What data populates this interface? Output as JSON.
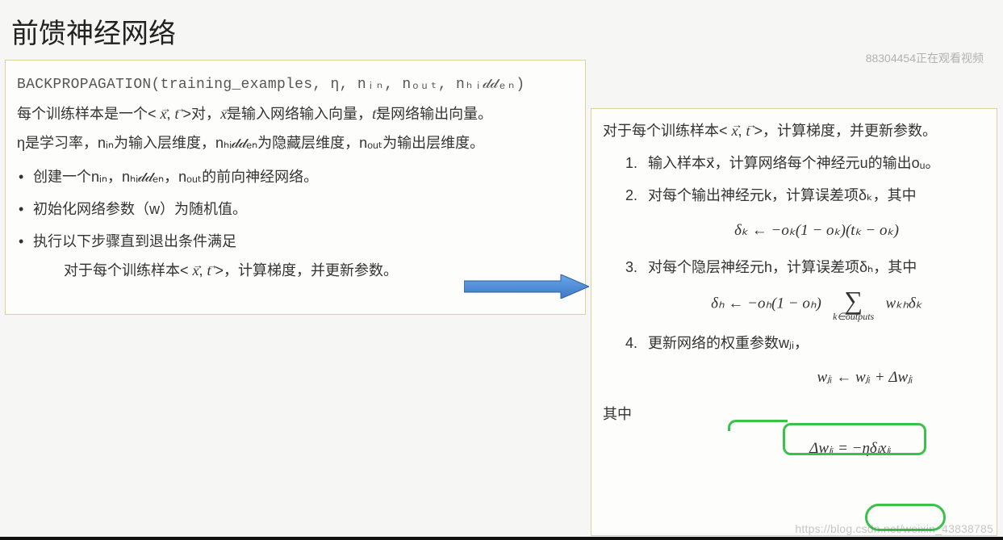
{
  "title": "前馈神经网络",
  "watermark_top": "88304454正在观看视频",
  "watermark_bottom": "https://blog.csdn.net/weixin_43838785",
  "left": {
    "signature": "BACKPROPAGATION(training_examples, η, nᵢₙ, nₒᵤₜ, nₕᵢ𝒹𝒹ₑₙ)",
    "line1_a": "每个训练样本是一个< ",
    "line1_b": " >对，",
    "line1_c": "是输入网络输入向量，",
    "line1_d": "是网络输出向量。",
    "line2": "η是学习率，nᵢₙ为输入层维度，nₕᵢ𝒹𝒹ₑₙ为隐藏层维度，nₒᵤₜ为输出层维度。",
    "bullet1": "创建一个nᵢₙ，nₕᵢ𝒹𝒹ₑₙ，nₒᵤₜ的前向神经网络。",
    "bullet2": "初始化网络参数（w）为随机值。",
    "bullet3": "执行以下步骤直到退出条件满足",
    "sub_a": "对于每个训练样本< ",
    "sub_b": " >，计算梯度，并更新参数。"
  },
  "right": {
    "head_a": "对于每个训练样本< ",
    "head_b": " >，计算梯度，并更新参数。",
    "item1": "输入样本x⃗，计算网络每个神经元u的输出oᵤ。",
    "item2": "对每个输出神经元k，计算误差项δₖ，其中",
    "eq1": "δₖ ← −oₖ(1 − oₖ)(tₖ − oₖ)",
    "item3": "对每个隐层神经元h，计算误差项δₕ，其中",
    "eq2_left": "δₕ ← −oₕ(1 − oₕ)",
    "eq2_sum_under": "k∈outputs",
    "eq2_right": "wₖₕδₖ",
    "item4": "更新网络的权重参数wⱼᵢ，",
    "eq3": "wⱼᵢ ← wⱼᵢ + Δwⱼᵢ",
    "where": "其中",
    "eq4": "Δwⱼᵢ = −ηδⱼxⱼᵢ"
  },
  "vec_x": "x",
  "vec_t": "t",
  "comma": ", "
}
